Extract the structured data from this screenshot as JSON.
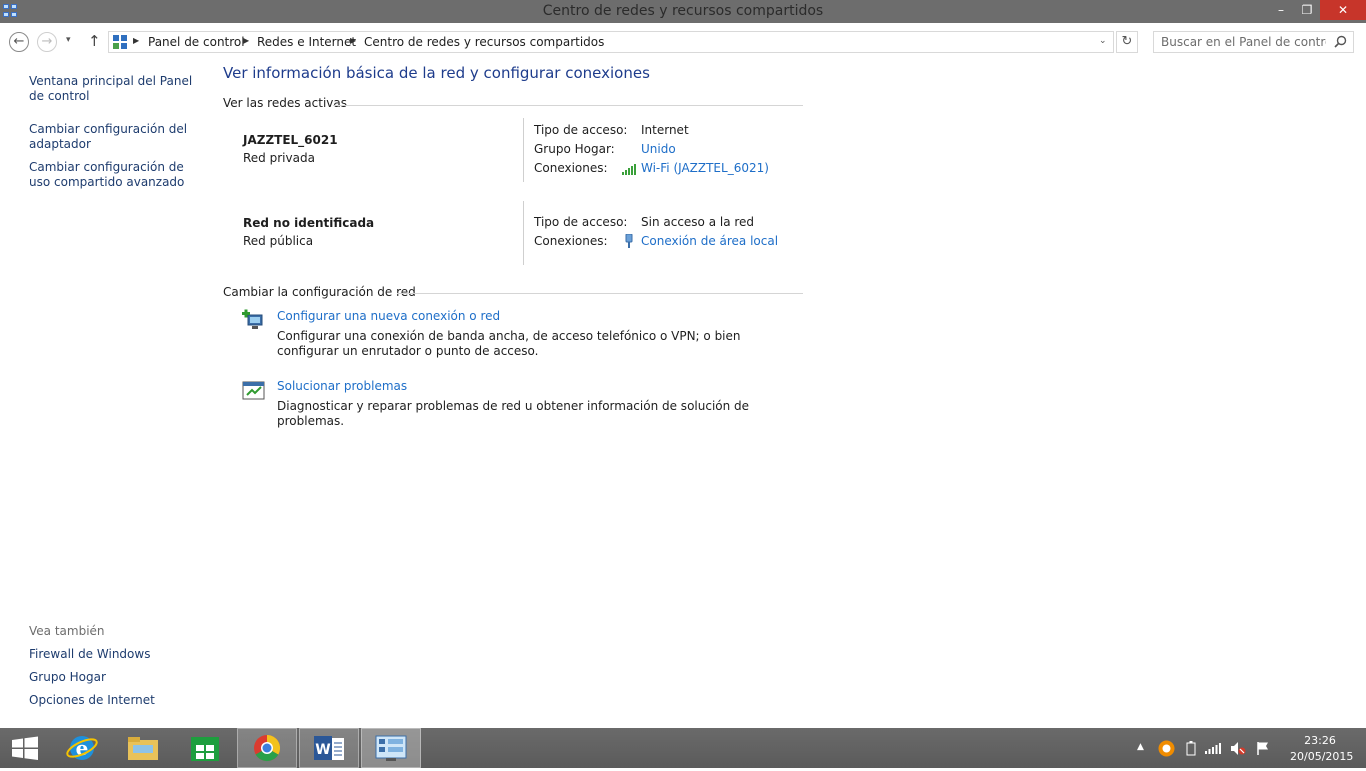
{
  "window": {
    "title": "Centro de redes y recursos compartidos",
    "min_glyph": "–",
    "max_glyph": "❐",
    "close_glyph": "✕"
  },
  "nav": {
    "back_glyph": "←",
    "forward_glyph": "→",
    "recent_glyph": "▾",
    "up_glyph": "↑"
  },
  "breadcrumb": {
    "items": [
      "Panel de control",
      "Redes e Internet",
      "Centro de redes y recursos compartidos"
    ],
    "separator": "▶",
    "dropdown_glyph": "⌄",
    "refresh_glyph": "↻"
  },
  "search": {
    "placeholder": "Buscar en el Panel de control"
  },
  "sidebar": {
    "links": [
      "Ventana principal del Panel de control",
      "Cambiar configuración del adaptador",
      "Cambiar configuración de uso compartido avanzado"
    ],
    "see_also_heading": "Vea también",
    "see_also": [
      "Firewall de Windows",
      "Grupo Hogar",
      "Opciones de Internet"
    ]
  },
  "main": {
    "title": "Ver información básica de la red y configurar conexiones",
    "active_networks_heading": "Ver las redes activas",
    "networks": [
      {
        "name": "JAZZTEL_6021",
        "category": "Red privada",
        "access_label": "Tipo de acceso:",
        "access_value": "Internet",
        "homegroup_label": "Grupo Hogar:",
        "homegroup_value": "Unido",
        "connections_label": "Conexiones:",
        "connection_value": "Wi-Fi (JAZZTEL_6021)",
        "connection_icon": "wifi-signal-icon"
      },
      {
        "name": "Red no identificada",
        "category": "Red pública",
        "access_label": "Tipo de acceso:",
        "access_value": "Sin acceso a la red",
        "connections_label": "Conexiones:",
        "connection_value": "Conexión de área local",
        "connection_icon": "ethernet-plug-icon"
      }
    ],
    "change_settings_heading": "Cambiar la configuración de red",
    "tasks": [
      {
        "link": "Configurar una nueva conexión o red",
        "description": "Configurar una conexión de banda ancha, de acceso telefónico o VPN; o bien configurar un enrutador o punto de acceso.",
        "icon": "new-connection-icon"
      },
      {
        "link": "Solucionar problemas",
        "description": "Diagnosticar y reparar problemas de red u obtener información de solución de problemas.",
        "icon": "troubleshoot-icon"
      }
    ]
  },
  "taskbar": {
    "apps": [
      "start-icon",
      "internet-explorer-icon",
      "file-explorer-icon",
      "store-icon",
      "chrome-icon",
      "word-icon",
      "control-panel-icon"
    ],
    "tray": {
      "show_hidden_glyph": "▲",
      "time": "23:26",
      "date": "20/05/2015"
    }
  },
  "colors": {
    "link": "#1e6ec8",
    "title": "#1e3c8c",
    "titlebar": "#6d6d6d",
    "close": "#c7352a",
    "taskbar": "#5e5e5e"
  }
}
